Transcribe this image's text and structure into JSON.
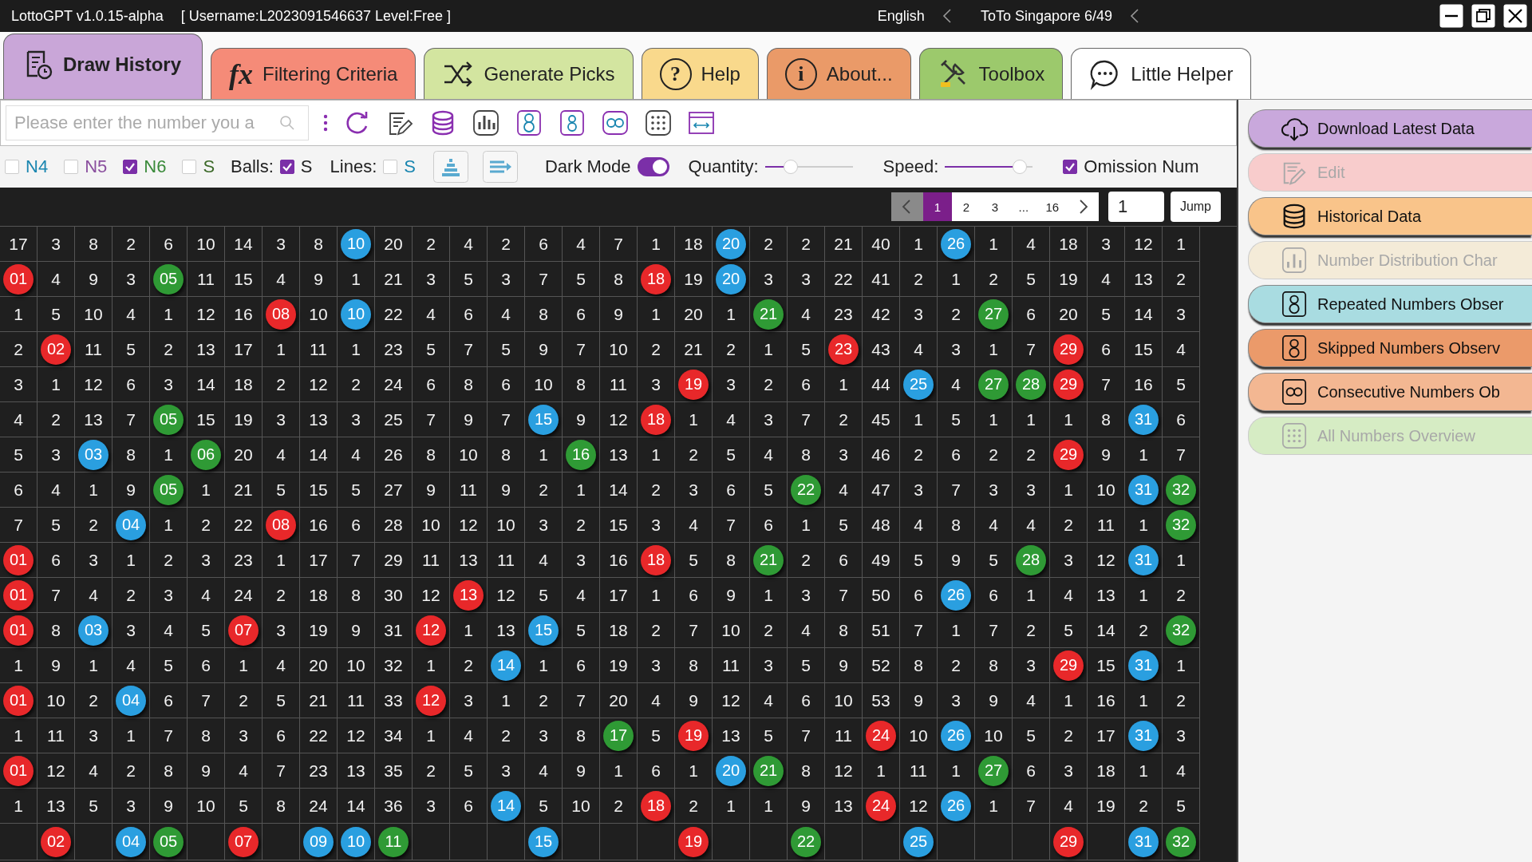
{
  "window": {
    "title": "LottoGPT v1.0.15-alpha",
    "user_info": "[ Username:L2023091546637  Level:Free ]",
    "language": "English",
    "lottery": "ToTo Singapore 6/49"
  },
  "tabs": [
    {
      "label": "Draw History",
      "selected": true,
      "color": "#c9a6d8"
    },
    {
      "label": "Filtering Criteria",
      "selected": false,
      "color": "#f58b78",
      "glyph": "fx"
    },
    {
      "label": "Generate Picks",
      "selected": false,
      "color": "#d3e5a0"
    },
    {
      "label": "Help",
      "selected": false,
      "color": "#f9d98c",
      "glyph": "?"
    },
    {
      "label": "About...",
      "selected": false,
      "color": "#ea9a68",
      "glyph": "i"
    },
    {
      "label": "Toolbox",
      "selected": false,
      "color": "#9cc96c"
    },
    {
      "label": "Little Helper",
      "selected": false,
      "color": "#ffffff"
    }
  ],
  "search": {
    "placeholder": "Please enter the number you a"
  },
  "filters": [
    {
      "label": "N4",
      "checked": false,
      "color": "#1a86b0"
    },
    {
      "label": "N5",
      "checked": false,
      "color": "#8a4f9e"
    },
    {
      "label": "N6",
      "checked": true,
      "color": "#3a8a3a"
    },
    {
      "label": "S",
      "checked": false,
      "color": "#3d6a2a"
    }
  ],
  "balls": {
    "label": "Balls:",
    "option": "S",
    "checked": true
  },
  "lines": {
    "label": "Lines:",
    "option": "S",
    "checked": false
  },
  "dark_mode": {
    "label": "Dark Mode",
    "on": true
  },
  "quantity": {
    "label": "Quantity:",
    "level": 0.25
  },
  "speed": {
    "label": "Speed:",
    "level": 0.92
  },
  "omission": {
    "label": "Omission Num",
    "checked": true
  },
  "pagination": {
    "pages": [
      {
        "label": "1",
        "selected": true
      },
      {
        "label": "2",
        "selected": false
      },
      {
        "label": "3",
        "selected": false
      },
      {
        "label": "...",
        "selected": false
      },
      {
        "label": "16",
        "selected": false
      }
    ],
    "page_input": "1",
    "jump": "Jump"
  },
  "grid": {
    "rows": [
      [
        "17",
        "3",
        "8",
        "2",
        "6",
        "10",
        "14",
        "3",
        "8",
        {
          "ball": "10",
          "color": "#2a9fe0"
        },
        "20",
        "2",
        "4",
        "2",
        "6",
        "4",
        "7",
        "1",
        "18",
        {
          "ball": "20",
          "color": "#2a9fe0"
        },
        "2",
        "2",
        "21",
        "40",
        "1",
        {
          "ball": "26",
          "color": "#2a9fe0"
        },
        "1",
        "4",
        "18",
        "3",
        "12",
        "1"
      ],
      [
        {
          "ball": "01",
          "color": "#e8282a"
        },
        "4",
        "9",
        "3",
        {
          "ball": "05",
          "color": "#2f9a35"
        },
        "11",
        "15",
        "4",
        "9",
        "1",
        "21",
        "3",
        "5",
        "3",
        "7",
        "5",
        "8",
        {
          "ball": "18",
          "color": "#e8282a"
        },
        "19",
        {
          "ball": "20",
          "color": "#2a9fe0"
        },
        "3",
        "3",
        "22",
        "41",
        "2",
        "1",
        "2",
        "5",
        "19",
        "4",
        "13",
        "2"
      ],
      [
        "1",
        "5",
        "10",
        "4",
        "1",
        "12",
        "16",
        {
          "ball": "08",
          "color": "#e8282a"
        },
        "10",
        {
          "ball": "10",
          "color": "#2a9fe0"
        },
        "22",
        "4",
        "6",
        "4",
        "8",
        "6",
        "9",
        "1",
        "20",
        "1",
        {
          "ball": "21",
          "color": "#2f9a35"
        },
        "4",
        "23",
        "42",
        "3",
        "2",
        {
          "ball": "27",
          "color": "#2f9a35"
        },
        "6",
        "20",
        "5",
        "14",
        "3"
      ],
      [
        "2",
        {
          "ball": "02",
          "color": "#e8282a"
        },
        "11",
        "5",
        "2",
        "13",
        "17",
        "1",
        "11",
        "1",
        "23",
        "5",
        "7",
        "5",
        "9",
        "7",
        "10",
        "2",
        "21",
        "2",
        "1",
        "5",
        {
          "ball": "23",
          "color": "#e8282a"
        },
        "43",
        "4",
        "3",
        "1",
        "7",
        {
          "ball": "29",
          "color": "#e8282a"
        },
        "6",
        "15",
        "4"
      ],
      [
        "3",
        "1",
        "12",
        "6",
        "3",
        "14",
        "18",
        "2",
        "12",
        "2",
        "24",
        "6",
        "8",
        "6",
        "10",
        "8",
        "11",
        "3",
        {
          "ball": "19",
          "color": "#e8282a"
        },
        "3",
        "2",
        "6",
        "1",
        "44",
        {
          "ball": "25",
          "color": "#2a9fe0"
        },
        "4",
        {
          "ball": "27",
          "color": "#2f9a35"
        },
        {
          "ball": "28",
          "color": "#2f9a35"
        },
        {
          "ball": "29",
          "color": "#e8282a"
        },
        "7",
        "16",
        "5"
      ],
      [
        "4",
        "2",
        "13",
        "7",
        {
          "ball": "05",
          "color": "#2f9a35"
        },
        "15",
        "19",
        "3",
        "13",
        "3",
        "25",
        "7",
        "9",
        "7",
        {
          "ball": "15",
          "color": "#2a9fe0"
        },
        "9",
        "12",
        {
          "ball": "18",
          "color": "#e8282a"
        },
        "1",
        "4",
        "3",
        "7",
        "2",
        "45",
        "1",
        "5",
        "1",
        "1",
        "1",
        "8",
        {
          "ball": "31",
          "color": "#2a9fe0"
        },
        "6"
      ],
      [
        "5",
        "3",
        {
          "ball": "03",
          "color": "#2a9fe0"
        },
        "8",
        "1",
        {
          "ball": "06",
          "color": "#2f9a35"
        },
        "20",
        "4",
        "14",
        "4",
        "26",
        "8",
        "10",
        "8",
        "1",
        {
          "ball": "16",
          "color": "#2f9a35"
        },
        "13",
        "1",
        "2",
        "5",
        "4",
        "8",
        "3",
        "46",
        "2",
        "6",
        "2",
        "2",
        {
          "ball": "29",
          "color": "#e8282a"
        },
        "9",
        "1",
        "7"
      ],
      [
        "6",
        "4",
        "1",
        "9",
        {
          "ball": "05",
          "color": "#2f9a35"
        },
        "1",
        "21",
        "5",
        "15",
        "5",
        "27",
        "9",
        "11",
        "9",
        "2",
        "1",
        "14",
        "2",
        "3",
        "6",
        "5",
        {
          "ball": "22",
          "color": "#2f9a35"
        },
        "4",
        "47",
        "3",
        "7",
        "3",
        "3",
        "1",
        "10",
        {
          "ball": "31",
          "color": "#2a9fe0"
        },
        {
          "ball": "32",
          "color": "#2f9a35"
        }
      ],
      [
        "7",
        "5",
        "2",
        {
          "ball": "04",
          "color": "#2a9fe0"
        },
        "1",
        "2",
        "22",
        {
          "ball": "08",
          "color": "#e8282a"
        },
        "16",
        "6",
        "28",
        "10",
        "12",
        "10",
        "3",
        "2",
        "15",
        "3",
        "4",
        "7",
        "6",
        "1",
        "5",
        "48",
        "4",
        "8",
        "4",
        "4",
        "2",
        "11",
        "1",
        {
          "ball": "32",
          "color": "#2f9a35"
        }
      ],
      [
        {
          "ball": "01",
          "color": "#e8282a"
        },
        "6",
        "3",
        "1",
        "2",
        "3",
        "23",
        "1",
        "17",
        "7",
        "29",
        "11",
        "13",
        "11",
        "4",
        "3",
        "16",
        {
          "ball": "18",
          "color": "#e8282a"
        },
        "5",
        "8",
        {
          "ball": "21",
          "color": "#2f9a35"
        },
        "2",
        "6",
        "49",
        "5",
        "9",
        "5",
        {
          "ball": "28",
          "color": "#2f9a35"
        },
        "3",
        "12",
        {
          "ball": "31",
          "color": "#2a9fe0"
        },
        "1"
      ],
      [
        {
          "ball": "01",
          "color": "#e8282a"
        },
        "7",
        "4",
        "2",
        "3",
        "4",
        "24",
        "2",
        "18",
        "8",
        "30",
        "12",
        {
          "ball": "13",
          "color": "#e8282a"
        },
        "12",
        "5",
        "4",
        "17",
        "1",
        "6",
        "9",
        "1",
        "3",
        "7",
        "50",
        "6",
        {
          "ball": "26",
          "color": "#2a9fe0"
        },
        "6",
        "1",
        "4",
        "13",
        "1",
        "2"
      ],
      [
        {
          "ball": "01",
          "color": "#e8282a"
        },
        "8",
        {
          "ball": "03",
          "color": "#2a9fe0"
        },
        "3",
        "4",
        "5",
        {
          "ball": "07",
          "color": "#e8282a"
        },
        "3",
        "19",
        "9",
        "31",
        {
          "ball": "12",
          "color": "#e8282a"
        },
        "1",
        "13",
        {
          "ball": "15",
          "color": "#2a9fe0"
        },
        "5",
        "18",
        "2",
        "7",
        "10",
        "2",
        "4",
        "8",
        "51",
        "7",
        "1",
        "7",
        "2",
        "5",
        "14",
        "2",
        {
          "ball": "32",
          "color": "#2f9a35"
        }
      ],
      [
        "1",
        "9",
        "1",
        "4",
        "5",
        "6",
        "1",
        "4",
        "20",
        "10",
        "32",
        "1",
        "2",
        {
          "ball": "14",
          "color": "#2a9fe0"
        },
        "1",
        "6",
        "19",
        "3",
        "8",
        "11",
        "3",
        "5",
        "9",
        "52",
        "8",
        "2",
        "8",
        "3",
        {
          "ball": "29",
          "color": "#e8282a"
        },
        "15",
        {
          "ball": "31",
          "color": "#2a9fe0"
        },
        "1"
      ],
      [
        {
          "ball": "01",
          "color": "#e8282a"
        },
        "10",
        "2",
        {
          "ball": "04",
          "color": "#2a9fe0"
        },
        "6",
        "7",
        "2",
        "5",
        "21",
        "11",
        "33",
        {
          "ball": "12",
          "color": "#e8282a"
        },
        "3",
        "1",
        "2",
        "7",
        "20",
        "4",
        "9",
        "12",
        "4",
        "6",
        "10",
        "53",
        "9",
        "3",
        "9",
        "4",
        "1",
        "16",
        "1",
        "2"
      ],
      [
        "1",
        "11",
        "3",
        "1",
        "7",
        "8",
        "3",
        "6",
        "22",
        "12",
        "34",
        "1",
        "4",
        "2",
        "3",
        "8",
        {
          "ball": "17",
          "color": "#2f9a35"
        },
        "5",
        {
          "ball": "19",
          "color": "#e8282a"
        },
        "13",
        "5",
        "7",
        "11",
        {
          "ball": "24",
          "color": "#e8282a"
        },
        "10",
        {
          "ball": "26",
          "color": "#2a9fe0"
        },
        "10",
        "5",
        "2",
        "17",
        {
          "ball": "31",
          "color": "#2a9fe0"
        },
        "3"
      ],
      [
        {
          "ball": "01",
          "color": "#e8282a"
        },
        "12",
        "4",
        "2",
        "8",
        "9",
        "4",
        "7",
        "23",
        "13",
        "35",
        "2",
        "5",
        "3",
        "4",
        "9",
        "1",
        "6",
        "1",
        {
          "ball": "20",
          "color": "#2a9fe0"
        },
        {
          "ball": "21",
          "color": "#2f9a35"
        },
        "8",
        "12",
        "1",
        "11",
        "1",
        {
          "ball": "27",
          "color": "#2f9a35"
        },
        "6",
        "3",
        "18",
        "1",
        "4"
      ],
      [
        "1",
        "13",
        "5",
        "3",
        "9",
        "10",
        "5",
        "8",
        "24",
        "14",
        "36",
        "3",
        "6",
        {
          "ball": "14",
          "color": "#2a9fe0"
        },
        "5",
        "10",
        "2",
        {
          "ball": "18",
          "color": "#e8282a"
        },
        "2",
        "1",
        "1",
        "9",
        "13",
        {
          "ball": "24",
          "color": "#e8282a"
        },
        "12",
        {
          "ball": "26",
          "color": "#2a9fe0"
        },
        "1",
        "7",
        "4",
        "19",
        "2",
        "5"
      ]
    ],
    "totals": [
      {
        "kind": "blank"
      },
      {
        "kind": "ball",
        "ball": "02",
        "color": "#e8282a"
      },
      {
        "kind": "blank"
      },
      {
        "kind": "ball",
        "ball": "04",
        "color": "#2a9fe0"
      },
      {
        "kind": "ball",
        "ball": "05",
        "color": "#2f9a35"
      },
      {
        "kind": "blank"
      },
      {
        "kind": "ball",
        "ball": "07",
        "color": "#e8282a"
      },
      {
        "kind": "blank"
      },
      {
        "kind": "ball",
        "ball": "09",
        "color": "#2a9fe0"
      },
      {
        "kind": "ball",
        "ball": "10",
        "color": "#2a9fe0"
      },
      {
        "kind": "ball",
        "ball": "11",
        "color": "#2f9a35"
      },
      {
        "kind": "blank"
      },
      {
        "kind": "blank"
      },
      {
        "kind": "blank"
      },
      {
        "kind": "ball",
        "ball": "15",
        "color": "#2a9fe0"
      },
      {
        "kind": "blank"
      },
      {
        "kind": "blank"
      },
      {
        "kind": "blank"
      },
      {
        "kind": "ball",
        "ball": "19",
        "color": "#e8282a"
      },
      {
        "kind": "blank"
      },
      {
        "kind": "blank"
      },
      {
        "kind": "ball",
        "ball": "22",
        "color": "#2f9a35"
      },
      {
        "kind": "blank"
      },
      {
        "kind": "blank"
      },
      {
        "kind": "ball",
        "ball": "25",
        "color": "#2a9fe0"
      },
      {
        "kind": "blank"
      },
      {
        "kind": "blank"
      },
      {
        "kind": "blank"
      },
      {
        "kind": "ball",
        "ball": "29",
        "color": "#e8282a"
      },
      {
        "kind": "blank"
      },
      {
        "kind": "ball",
        "ball": "31",
        "color": "#2a9fe0"
      },
      {
        "kind": "ball",
        "ball": "32",
        "color": "#2f9a35"
      }
    ]
  },
  "sidebar": {
    "items": [
      {
        "label": "Download Latest Data",
        "disabled": false,
        "color": "#c9a8dc"
      },
      {
        "label": "Edit",
        "disabled": true,
        "color": "#f8cccc"
      },
      {
        "label": "Historical Data",
        "disabled": false,
        "color": "#f9c48a"
      },
      {
        "label": "Number Distribution Char",
        "disabled": true,
        "color": "#f4ebd8"
      },
      {
        "label": "Repeated Numbers Obser",
        "disabled": false,
        "color": "#a9dce1"
      },
      {
        "label": "Skipped Numbers Observ",
        "disabled": false,
        "color": "#eb9a6a"
      },
      {
        "label": "Consecutive Numbers Ob",
        "disabled": false,
        "color": "#f3b792"
      },
      {
        "label": "All Numbers Overview",
        "disabled": true,
        "color": "#d6ecc4"
      }
    ]
  }
}
